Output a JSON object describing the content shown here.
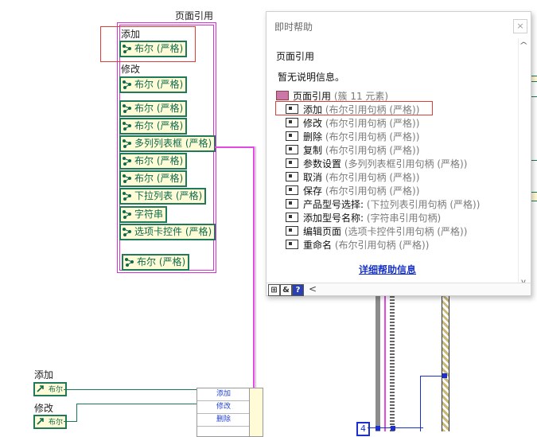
{
  "block_diagram": {
    "title": "页面引用",
    "labels": {
      "add": "添加",
      "modify": "修改"
    },
    "terminals": [
      "布尔 (严格)",
      "布尔 (严格)",
      "布尔 (严格)",
      "布尔 (严格)",
      "多列列表框 (严格)",
      "布尔 (严格)",
      "布尔 (严格)",
      "下拉列表 (严格)",
      "字符串",
      "选项卡控件 (严格)",
      "布尔 (严格)"
    ],
    "bottom_labels": {
      "add": "添加",
      "modify": "修改"
    },
    "bottom_terminals": [
      "布尔",
      "布尔"
    ],
    "bundler_items": [
      "添加",
      "修改",
      "删除"
    ],
    "constant_value": "4"
  },
  "help": {
    "window_title": "即时帮助",
    "close_glyph": "×",
    "heading": "页面引用",
    "description": "暂无说明信息。",
    "cluster_name": "页面引用",
    "cluster_sub": "(簇 11 元素)",
    "elements": [
      {
        "name": "添加",
        "type": "(布尔引用句柄 (严格))"
      },
      {
        "name": "修改",
        "type": "(布尔引用句柄 (严格))"
      },
      {
        "name": "删除",
        "type": "(布尔引用句柄 (严格))"
      },
      {
        "name": "复制",
        "type": "(布尔引用句柄 (严格))"
      },
      {
        "name": "参数设置",
        "type": "(多列列表框引用句柄 (严格))"
      },
      {
        "name": "取消",
        "type": "(布尔引用句柄 (严格))"
      },
      {
        "name": "保存",
        "type": "(布尔引用句柄 (严格))"
      },
      {
        "name": "产品型号选择:",
        "type": "(下拉列表引用句柄 (严格))"
      },
      {
        "name": "添加型号名称:",
        "type": "(字符串引用句柄)"
      },
      {
        "name": "编辑页面",
        "type": "(选项卡控件引用句柄 (严格))"
      },
      {
        "name": "重命名",
        "type": "(布尔引用句柄 (严格))"
      }
    ],
    "detail_link": "详细帮助信息",
    "footer_buttons": [
      "lock-icon",
      "eye-icon",
      "?"
    ],
    "scroll_left": "<",
    "scroll_up": "^",
    "scroll_down": "v"
  },
  "colors": {
    "terminal_border": "#1f7a5a",
    "terminal_fill": "#fffbd6",
    "cluster_wire": "#e24ae2",
    "highlight": "#e23b3b",
    "link": "#1a34c8"
  }
}
